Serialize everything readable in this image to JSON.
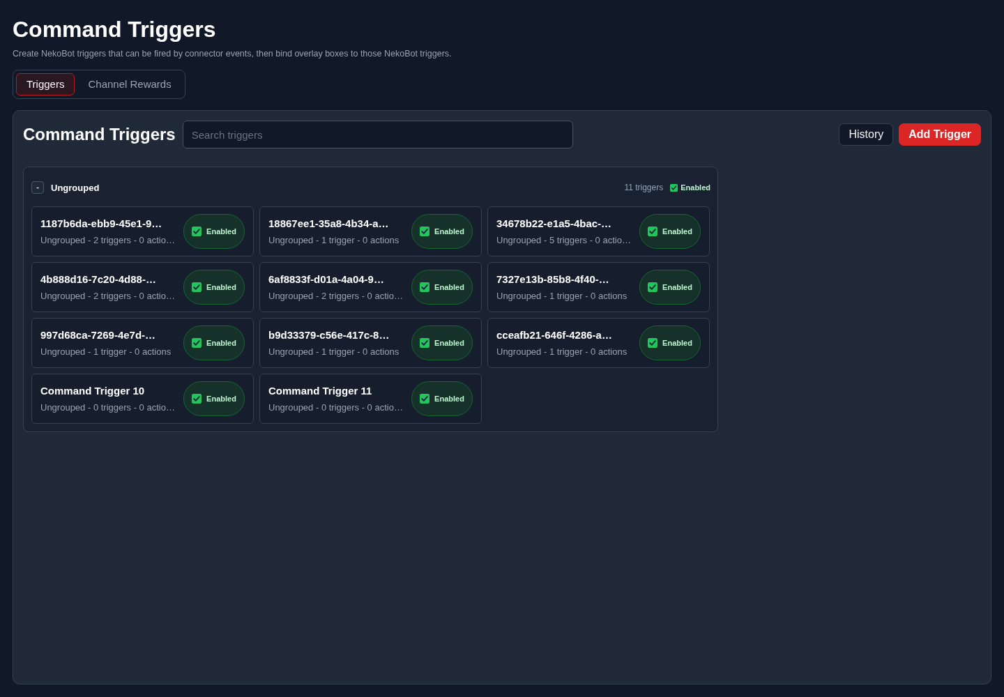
{
  "page": {
    "title": "Command Triggers",
    "subtitle": "Create NekoBot triggers that can be fired by connector events, then bind overlay boxes to those NekoBot triggers."
  },
  "tabs": [
    {
      "label": "Triggers",
      "selected": true
    },
    {
      "label": "Channel Rewards",
      "selected": false
    }
  ],
  "panel": {
    "title": "Command Triggers",
    "search": {
      "placeholder": "Search triggers"
    },
    "buttons": [
      {
        "label": "History",
        "kind": "secondary"
      },
      {
        "label": "Add Trigger",
        "kind": "primary"
      }
    ]
  },
  "groups": [
    {
      "name": "Ungrouped",
      "toggle": "-",
      "count": "11 triggers",
      "enabled": true,
      "enabled_label": "Enabled",
      "triggers": [
        {
          "name": "1187b6da-ebb9-45e1-9…",
          "summary": "Ungrouped - 2 triggers - 0 actio…",
          "enabled": true,
          "toggle_label": "Enabled"
        },
        {
          "name": "18867ee1-35a8-4b34-a…",
          "summary": "Ungrouped - 1 trigger - 0 actions",
          "enabled": true,
          "toggle_label": "Enabled"
        },
        {
          "name": "34678b22-e1a5-4bac-…",
          "summary": "Ungrouped - 5 triggers - 0 actio…",
          "enabled": true,
          "toggle_label": "Enabled"
        },
        {
          "name": "4b888d16-7c20-4d88-…",
          "summary": "Ungrouped - 2 triggers - 0 actio…",
          "enabled": true,
          "toggle_label": "Enabled"
        },
        {
          "name": "6af8833f-d01a-4a04-9…",
          "summary": "Ungrouped - 2 triggers - 0 actio…",
          "enabled": true,
          "toggle_label": "Enabled"
        },
        {
          "name": "7327e13b-85b8-4f40-…",
          "summary": "Ungrouped - 1 trigger - 0 actions",
          "enabled": true,
          "toggle_label": "Enabled"
        },
        {
          "name": "997d68ca-7269-4e7d-…",
          "summary": "Ungrouped - 1 trigger - 0 actions",
          "enabled": true,
          "toggle_label": "Enabled"
        },
        {
          "name": "b9d33379-c56e-417c-8…",
          "summary": "Ungrouped - 1 trigger - 0 actions",
          "enabled": true,
          "toggle_label": "Enabled"
        },
        {
          "name": "cceafb21-646f-4286-a…",
          "summary": "Ungrouped - 1 trigger - 0 actions",
          "enabled": true,
          "toggle_label": "Enabled"
        },
        {
          "name": "Command Trigger 10",
          "summary": "Ungrouped - 0 triggers - 0 actio…",
          "enabled": true,
          "toggle_label": "Enabled"
        },
        {
          "name": "Command Trigger 11",
          "summary": "Ungrouped - 0 triggers - 0 actio…",
          "enabled": true,
          "toggle_label": "Enabled"
        }
      ]
    }
  ]
}
